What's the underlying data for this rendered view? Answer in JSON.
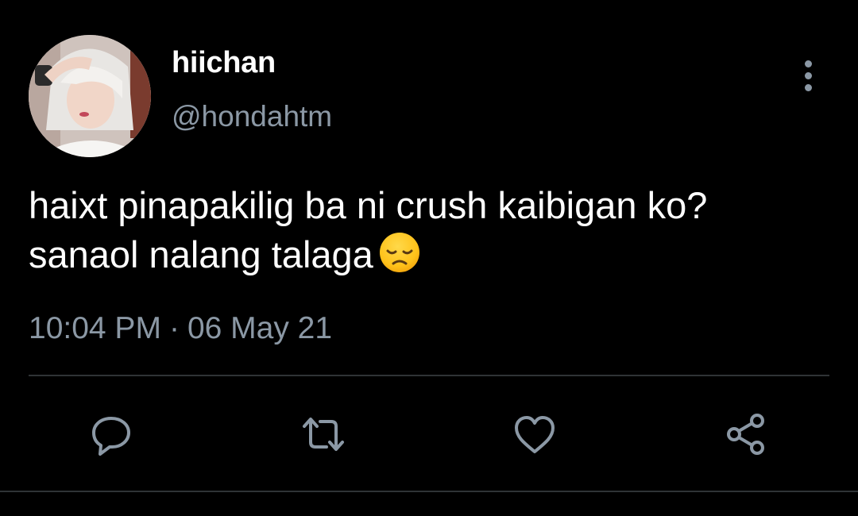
{
  "tweet": {
    "author": {
      "display_name": "hiichan",
      "handle": "@hondahtm"
    },
    "text_lines": [
      "haixt pinapakilig ba ni crush kaibigan ko?",
      "sanaol nalang talaga"
    ],
    "emoji": "disappointed-face-emoji",
    "time": "10:04 PM",
    "separator": "·",
    "date": "06 May 21"
  },
  "actions": {
    "icons": [
      "reply-icon",
      "retweet-icon",
      "like-icon",
      "share-icon"
    ]
  },
  "colors": {
    "background": "#000000",
    "primary_text": "#ffffff",
    "secondary_text": "#8b98a5",
    "divider": "#2f3336"
  }
}
